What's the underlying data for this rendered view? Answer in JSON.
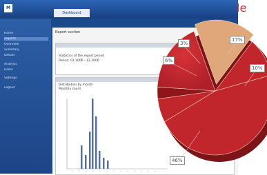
{
  "window": {
    "logo_text": "M",
    "brand": "",
    "tab_title": "Dashboard"
  },
  "sidebar": {
    "items": [
      {
        "label": "Home"
      },
      {
        "label": "Reports",
        "active": true
      },
      {
        "label": "Overview"
      },
      {
        "label": "Summary"
      },
      {
        "label": "Details"
      },
      {
        "label": "Analysis"
      },
      {
        "label": "Users"
      },
      {
        "label": "Settings"
      },
      {
        "label": "Logout"
      }
    ]
  },
  "main": {
    "breadcrumb": "Report section",
    "panel1_line1": "Statistics of the report period",
    "panel1_line2": "Period: 01.2006 - 12.2006",
    "panel2_line1": "Distribution by month",
    "panel2_line2": "Monthly count"
  },
  "corner_label": "le",
  "chart_data": {
    "type": "pie",
    "slices": [
      {
        "label": "46%",
        "value": 46
      },
      {
        "label": "17%",
        "value": 17
      },
      {
        "label": "10%",
        "value": 10
      },
      {
        "label": "6%",
        "value": 6
      },
      {
        "label": "3%",
        "value": 3
      }
    ]
  },
  "colors": {
    "pie_red": "#c0262b",
    "pie_dark_red": "#8f151a",
    "pie_tan": "#e0a77a",
    "app_blue": "#1a4a8c"
  }
}
